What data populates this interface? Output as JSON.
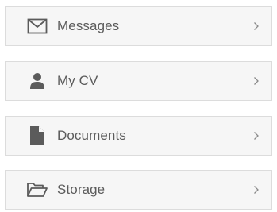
{
  "menu": {
    "items": [
      {
        "label": "Messages",
        "icon": "envelope-icon"
      },
      {
        "label": "My CV",
        "icon": "user-icon"
      },
      {
        "label": "Documents",
        "icon": "document-icon"
      },
      {
        "label": "Storage",
        "icon": "folder-open-icon"
      }
    ],
    "chevron": ">"
  },
  "colors": {
    "item_background": "#f6f6f6",
    "item_border": "#dcdcdc",
    "text": "#5b5b5b",
    "icon": "#5b5b5b",
    "chevron": "#8a8a8a"
  }
}
